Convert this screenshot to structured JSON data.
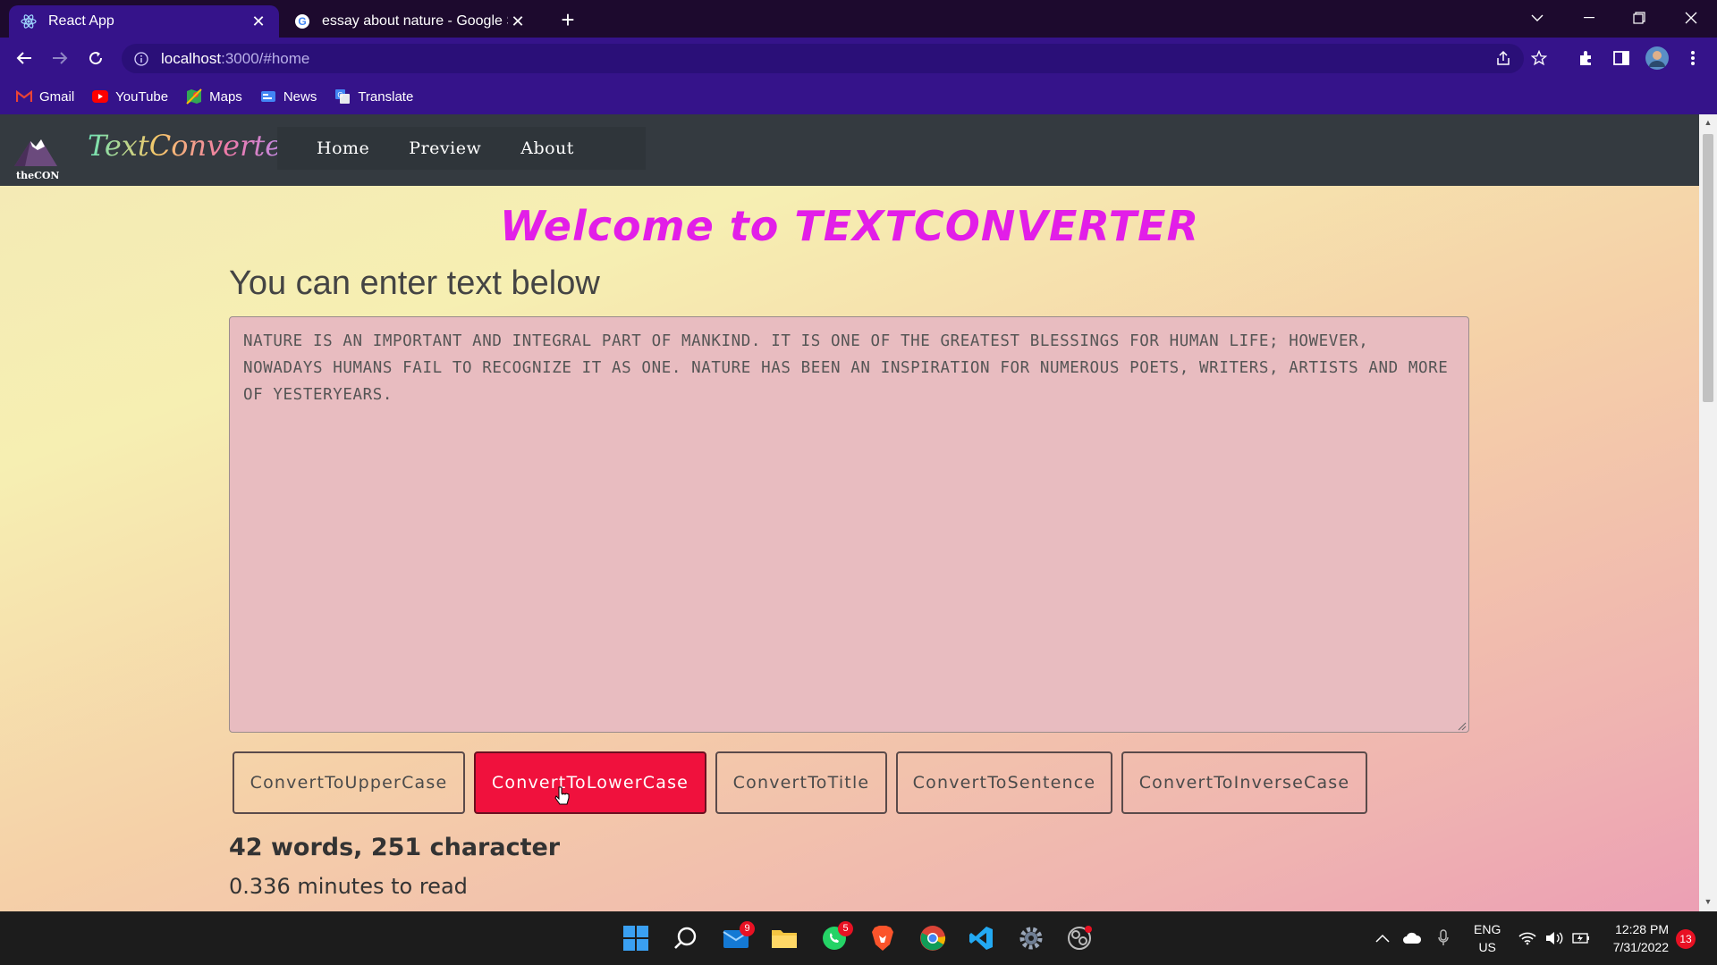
{
  "browser": {
    "tabs": [
      {
        "title": "React App",
        "icon": "react-icon",
        "active": true
      },
      {
        "title": "essay about nature - Google Sear",
        "icon": "google-icon",
        "active": false
      }
    ],
    "url_host": "localhost",
    "url_path": ":3000/#home",
    "bookmarks": [
      {
        "label": "Gmail",
        "icon": "gmail-icon"
      },
      {
        "label": "YouTube",
        "icon": "youtube-icon"
      },
      {
        "label": "Maps",
        "icon": "maps-icon"
      },
      {
        "label": "News",
        "icon": "news-icon"
      },
      {
        "label": "Translate",
        "icon": "translate-icon"
      }
    ]
  },
  "app": {
    "logo_text": "theCON",
    "brand": "TextConverter",
    "menu": [
      "Home",
      "Preview",
      "About"
    ],
    "welcome": "Welcome to TEXTCONVERTER",
    "subtitle": "You can enter text below",
    "text_value": "NATURE IS AN IMPORTANT AND INTEGRAL PART OF MANKIND. IT IS ONE OF THE GREATEST BLESSINGS FOR HUMAN LIFE; HOWEVER, NOWADAYS HUMANS FAIL TO RECOGNIZE IT AS ONE. NATURE HAS BEEN AN INSPIRATION FOR NUMEROUS POETS, WRITERS, ARTISTS AND MORE OF YESTERYEARS.",
    "buttons": [
      "ConvertToUpperCase",
      "ConvertToLowerCase",
      "ConvertToTitle",
      "ConvertToSentence",
      "ConvertToInverseCase"
    ],
    "active_button": "ConvertToLowerCase",
    "stats": "42 words, 251 character",
    "read_time": "0.336 minutes to read"
  },
  "taskbar": {
    "mail_badge": "9",
    "whatsapp_badge": "5",
    "lang_line1": "ENG",
    "lang_line2": "US",
    "time": "12:28 PM",
    "date": "7/31/2022",
    "notifications": "13"
  },
  "colors": {
    "browser_accent": "#35138a",
    "nav_bg": "#343a40",
    "welcome": "#e21ee8",
    "active_button": "#f0113d"
  }
}
